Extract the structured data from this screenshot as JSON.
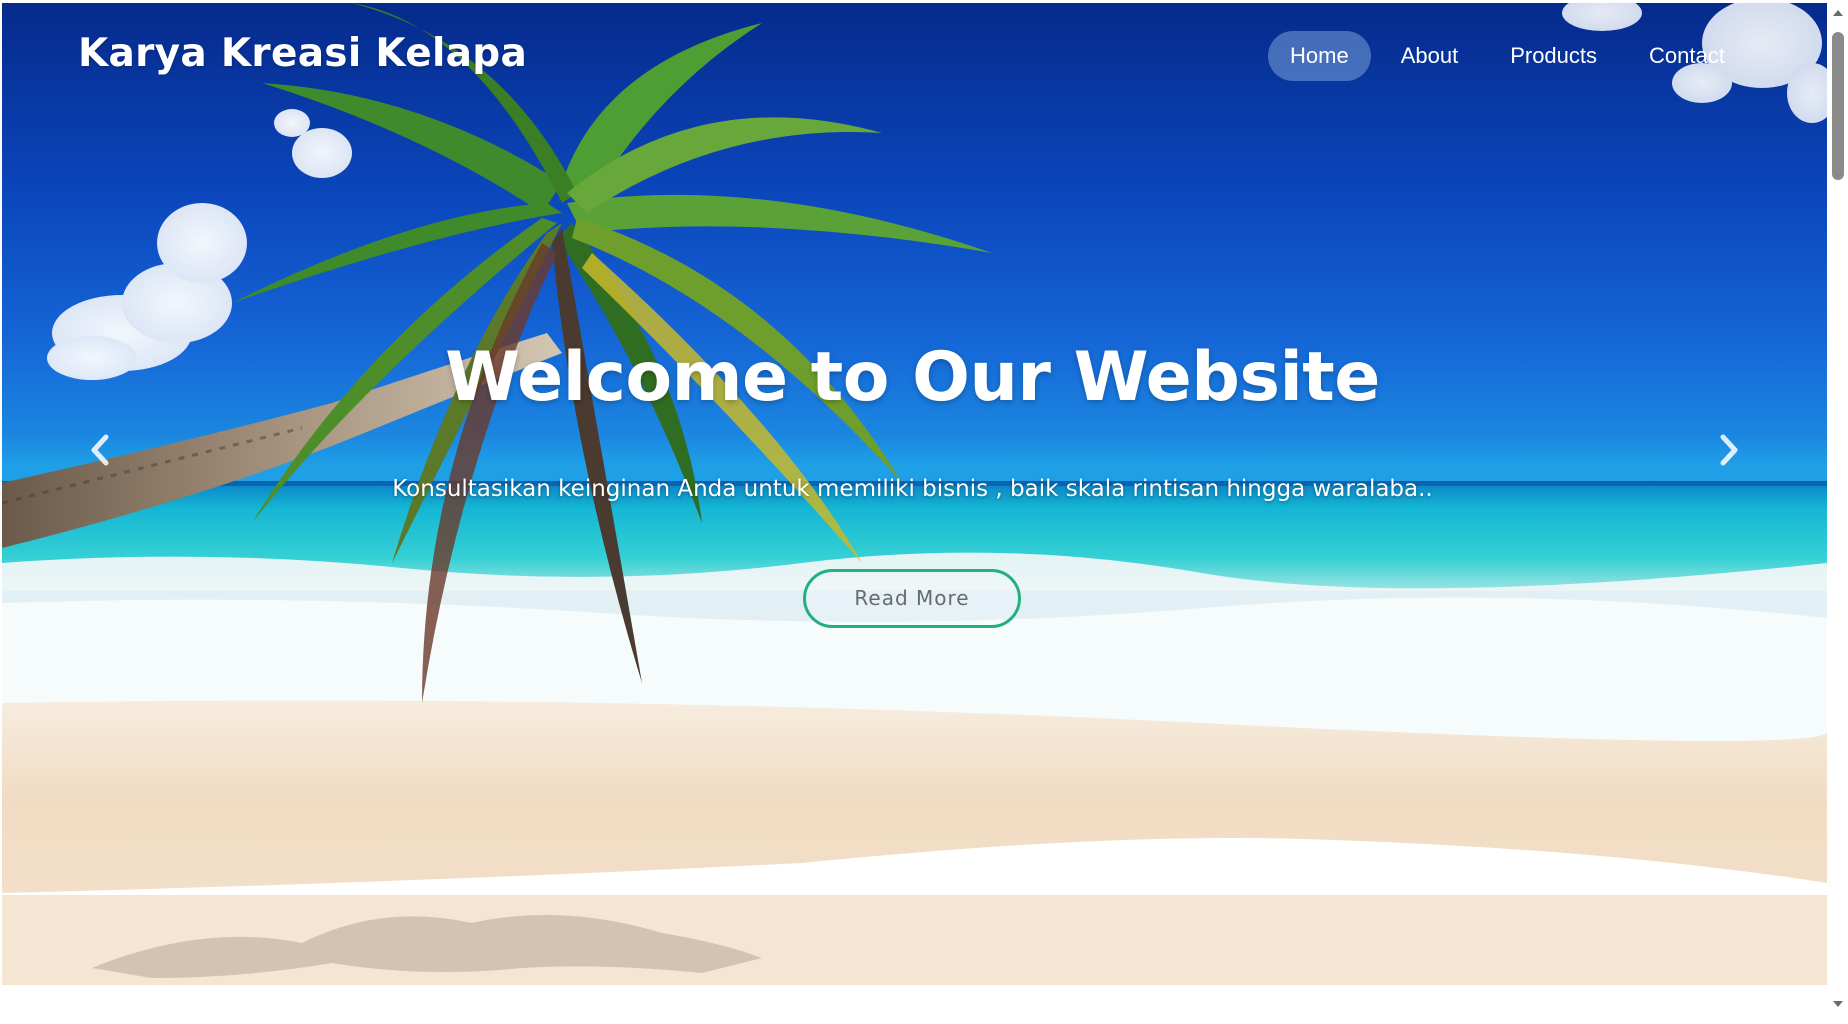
{
  "brand": {
    "name": "Karya Kreasi Kelapa"
  },
  "nav": {
    "items": [
      {
        "label": "Home",
        "active": true
      },
      {
        "label": "About",
        "active": false
      },
      {
        "label": "Products",
        "active": false
      },
      {
        "label": "Contact",
        "active": false
      }
    ]
  },
  "hero": {
    "title": "Welcome to Our Website",
    "subtitle": "Konsultasikan keinginan Anda untuk memiliki bisnis , baik skala rintisan hingga waralaba..",
    "button_label": "Read More",
    "prev_icon": "chevron-left-icon",
    "next_icon": "chevron-right-icon"
  },
  "colors": {
    "sky_top": "#062a8c",
    "sky_bottom": "#1e9fe6",
    "sea": "#1fc7d4",
    "sand": "#f3dfc6",
    "button_border": "#22b07e",
    "nav_active_bg": "#5f86c8"
  }
}
